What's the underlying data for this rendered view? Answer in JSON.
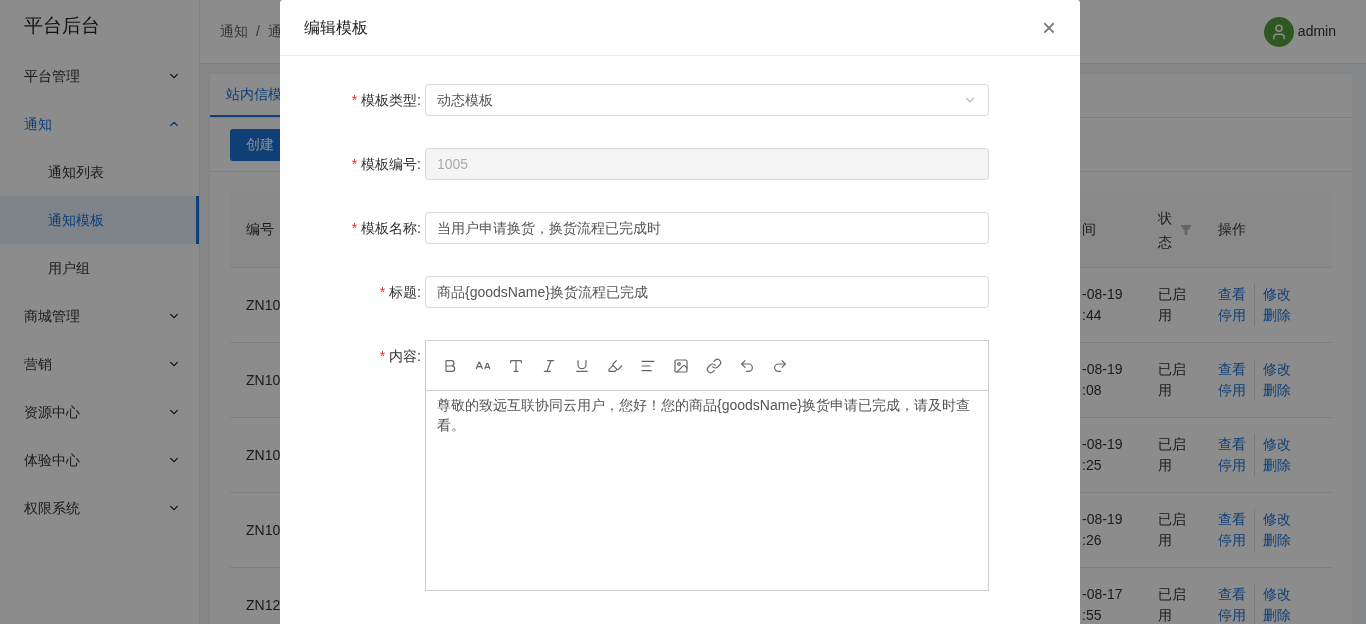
{
  "sidebar": {
    "title": "平台后台",
    "items": [
      {
        "label": "平台管理",
        "expanded": false,
        "selected": false
      },
      {
        "label": "通知",
        "expanded": true,
        "selected": true,
        "children": [
          {
            "label": "通知列表",
            "selected": false
          },
          {
            "label": "通知模板",
            "selected": true
          },
          {
            "label": "用户组",
            "selected": false
          }
        ]
      },
      {
        "label": "商城管理",
        "expanded": false,
        "selected": false
      },
      {
        "label": "营销",
        "expanded": false,
        "selected": false
      },
      {
        "label": "资源中心",
        "expanded": false,
        "selected": false
      },
      {
        "label": "体验中心",
        "expanded": false,
        "selected": false
      },
      {
        "label": "权限系统",
        "expanded": false,
        "selected": false
      }
    ]
  },
  "header": {
    "breadcrumb": [
      "通知",
      "通"
    ],
    "separator": "/",
    "user": "admin"
  },
  "tabs": [
    {
      "label": "站内信模",
      "selected": true
    }
  ],
  "create_button": "创建",
  "table": {
    "columns": [
      "编号",
      "间",
      "状态",
      "操作"
    ],
    "rows": [
      {
        "id": "ZN10",
        "time": [
          "-08-19",
          ":44"
        ],
        "status": [
          "已启",
          "用"
        ],
        "actions": [
          "查看",
          "修改",
          "停用",
          "删除"
        ]
      },
      {
        "id": "ZN10",
        "time": [
          "-08-19",
          ":08"
        ],
        "status": [
          "已启",
          "用"
        ],
        "actions": [
          "查看",
          "修改",
          "停用",
          "删除"
        ]
      },
      {
        "id": "ZN10",
        "time": [
          "-08-19",
          ":25"
        ],
        "status": [
          "已启",
          "用"
        ],
        "actions": [
          "查看",
          "修改",
          "停用",
          "删除"
        ]
      },
      {
        "id": "ZN10",
        "time": [
          "-08-19",
          ":26"
        ],
        "status": [
          "已启",
          "用"
        ],
        "actions": [
          "查看",
          "修改",
          "停用",
          "删除"
        ]
      },
      {
        "id": "ZN12",
        "time": [
          "-08-17",
          ":55"
        ],
        "status": [
          "已启",
          "用"
        ],
        "actions": [
          "查看",
          "修改",
          "停用",
          "删除"
        ]
      }
    ]
  },
  "modal": {
    "title": "编辑模板",
    "close": "×",
    "fields": [
      {
        "kind": "select",
        "required_mark": "*",
        "label": "模板类型:",
        "value": "动态模板",
        "disabled": false
      },
      {
        "kind": "input",
        "required_mark": "*",
        "label": "模板编号:",
        "value": "1005",
        "disabled": true
      },
      {
        "kind": "input",
        "required_mark": "*",
        "label": "模板名称:",
        "value": "当用户申请换货，换货流程已完成时",
        "disabled": false
      },
      {
        "kind": "input",
        "required_mark": "*",
        "label": "标题:",
        "value": "商品{goodsName}换货流程已完成",
        "disabled": false
      },
      {
        "kind": "editor",
        "required_mark": "*",
        "label": "内容:",
        "value": "尊敬的致远互联协同云用户，您好！您的商品{goodsName}换货申请已完成，请及时查看。"
      }
    ]
  }
}
